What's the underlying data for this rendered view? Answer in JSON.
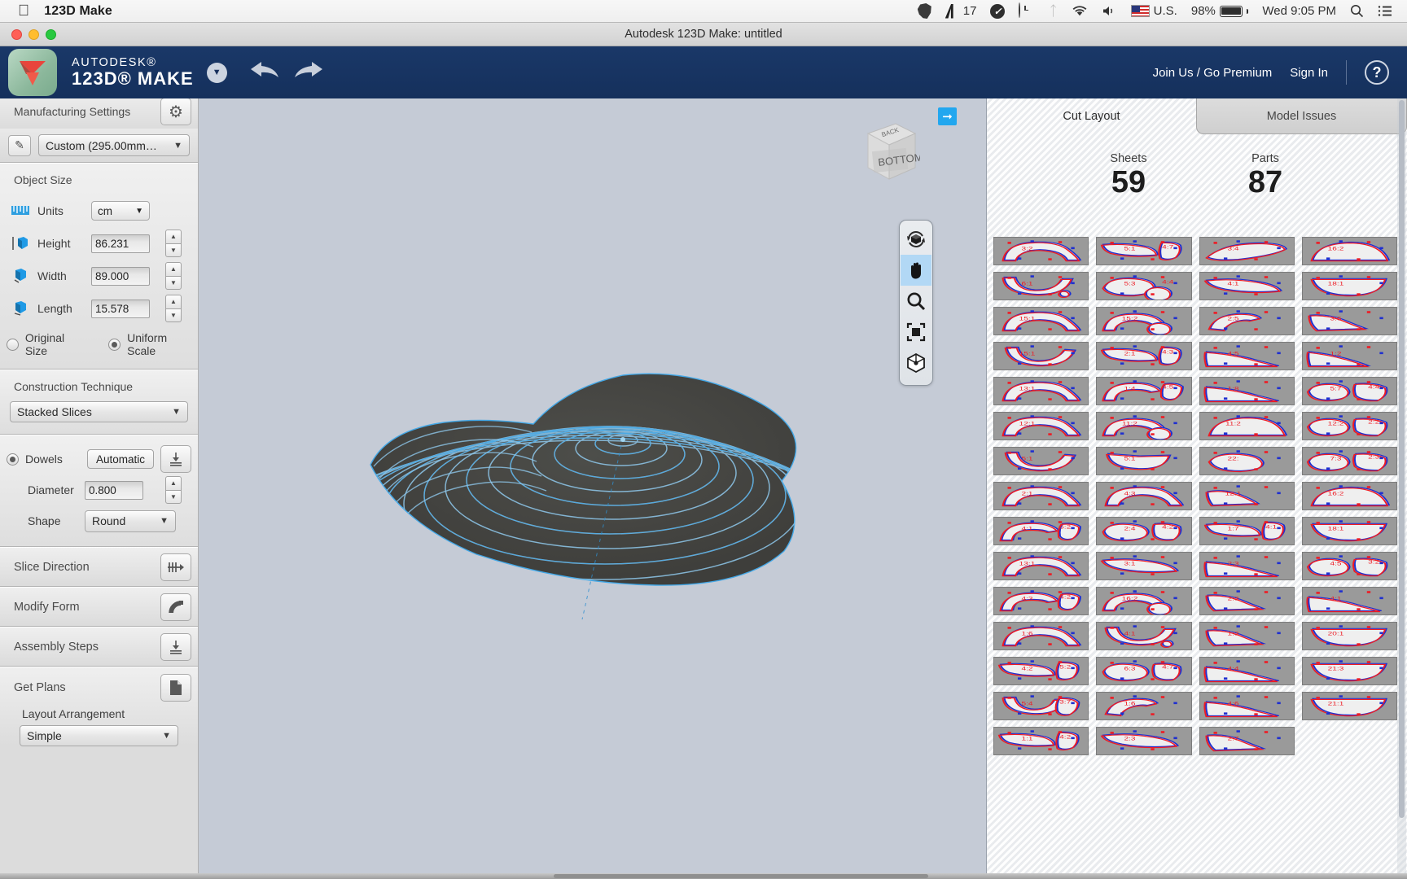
{
  "menubar": {
    "apple_icon": "apple-logo",
    "app_name": "123D Make",
    "status_items": [
      {
        "icon": "evernote-icon",
        "label": ""
      },
      {
        "icon": "autodesk-a-icon",
        "label": "17"
      },
      {
        "icon": "check-badge-icon",
        "label": ""
      },
      {
        "icon": "clock-icon",
        "label": ""
      },
      {
        "icon": "bluetooth-icon",
        "label": ""
      },
      {
        "icon": "wifi-icon",
        "label": ""
      },
      {
        "icon": "volume-icon",
        "label": ""
      },
      {
        "icon": "us-flag-icon",
        "label": "U.S."
      },
      {
        "icon": "battery-icon",
        "label": "98%"
      }
    ],
    "clock": "Wed 9:05 PM",
    "search_icon": "search-icon",
    "notification_icon": "list-icon"
  },
  "window": {
    "title": "Autodesk 123D Make: untitled"
  },
  "toolbar": {
    "brand_line1": "AUTODESK®",
    "brand_line2": "123D® MAKE",
    "dropdown_icon": "chevron-down-icon",
    "undo_icon": "undo-arrow-icon",
    "redo_icon": "redo-arrow-icon",
    "join_label": "Join Us / Go Premium",
    "signin_label": "Sign In",
    "help_label": "?"
  },
  "sidebar": {
    "manufacturing": {
      "title": "Manufacturing Settings",
      "gear_icon": "gear-icon",
      "pencil_icon": "pencil-icon",
      "material_value": "Custom (295.00mm…"
    },
    "object_size": {
      "title": "Object Size",
      "units_label": "Units",
      "units_value": "cm",
      "height_label": "Height",
      "height_value": "86.231",
      "width_label": "Width",
      "width_value": "89.000",
      "length_label": "Length",
      "length_value": "15.578",
      "original_size_label": "Original Size",
      "uniform_scale_label": "Uniform Scale",
      "selected_scale": "Uniform Scale"
    },
    "construction": {
      "title": "Construction Technique",
      "value": "Stacked Slices"
    },
    "dowels": {
      "label": "Dowels",
      "mode": "Automatic",
      "diameter_label": "Diameter",
      "diameter_value": "0.800",
      "shape_label": "Shape",
      "shape_value": "Round"
    },
    "sections": [
      {
        "label": "Slice Direction",
        "icon": "slice-direction-icon"
      },
      {
        "label": "Modify Form",
        "icon": "modify-form-icon"
      },
      {
        "label": "Assembly Steps",
        "icon": "assembly-steps-icon"
      }
    ],
    "get_plans": {
      "label": "Get Plans",
      "icon": "page-icon",
      "layout_label": "Layout Arrangement",
      "layout_value": "Simple"
    }
  },
  "viewport": {
    "expand_icon": "arrow-right-icon",
    "viewcube_top": "BACK",
    "viewcube_front": "BOTTOM",
    "nav_tools": [
      {
        "icon": "orbit-icon",
        "active": false
      },
      {
        "icon": "pan-hand-icon",
        "active": true
      },
      {
        "icon": "zoom-magnifier-icon",
        "active": false
      },
      {
        "icon": "fit-to-screen-icon",
        "active": false
      },
      {
        "icon": "view-cube-icon",
        "active": false
      }
    ]
  },
  "right_panel": {
    "tabs": [
      {
        "label": "Cut Layout",
        "active": true
      },
      {
        "label": "Model Issues",
        "active": false
      }
    ],
    "sheets_label": "Sheets",
    "sheets_value": "59",
    "parts_label": "Parts",
    "parts_value": "87",
    "thumbnails": [
      {
        "labels": [
          "3:2"
        ],
        "shape": "arch"
      },
      {
        "labels": [
          "5:1",
          "4:7"
        ],
        "shape": "sliver-pair"
      },
      {
        "labels": [
          "3:4"
        ],
        "shape": "blade"
      },
      {
        "labels": [
          "16:2"
        ],
        "shape": "dome"
      },
      {
        "labels": [
          "6:1"
        ],
        "shape": "bowl-dot"
      },
      {
        "labels": [
          "5:3",
          "4:4"
        ],
        "shape": "blob-circle"
      },
      {
        "labels": [
          "4:1"
        ],
        "shape": "sliver"
      },
      {
        "labels": [
          "18:1"
        ],
        "shape": "half-dome"
      },
      {
        "labels": [
          "15:1"
        ],
        "shape": "arch"
      },
      {
        "labels": [
          "15:2"
        ],
        "shape": "arch-circle"
      },
      {
        "labels": [
          "2:5"
        ],
        "shape": "hook"
      },
      {
        "labels": [
          "3:6"
        ],
        "shape": "wedge"
      },
      {
        "labels": [
          "15:1"
        ],
        "shape": "bowl"
      },
      {
        "labels": [
          "2:1",
          "4:3"
        ],
        "shape": "sliver-pair"
      },
      {
        "labels": [
          "4:5"
        ],
        "shape": "curve"
      },
      {
        "labels": [
          "1:2"
        ],
        "shape": "curve-box"
      },
      {
        "labels": [
          "13:1"
        ],
        "shape": "arch"
      },
      {
        "labels": [
          "1:4",
          "4:5"
        ],
        "shape": "arch-pair"
      },
      {
        "labels": [
          "1:8"
        ],
        "shape": "curve"
      },
      {
        "labels": [
          "5:7",
          "4:4"
        ],
        "shape": "double-blob"
      },
      {
        "labels": [
          "12:1"
        ],
        "shape": "arch"
      },
      {
        "labels": [
          "11:2"
        ],
        "shape": "arch-circle"
      },
      {
        "labels": [
          "11:2"
        ],
        "shape": "dome"
      },
      {
        "labels": [
          "12:2",
          "2:2"
        ],
        "shape": "double-blob"
      },
      {
        "labels": [
          "5:1"
        ],
        "shape": "bowl"
      },
      {
        "labels": [
          "5:1"
        ],
        "shape": "bowl-small"
      },
      {
        "labels": [
          "22:"
        ],
        "shape": "blob"
      },
      {
        "labels": [
          "7:3",
          "2:3"
        ],
        "shape": "double-blob"
      },
      {
        "labels": [
          "2:1"
        ],
        "shape": "arch"
      },
      {
        "labels": [
          "4:3"
        ],
        "shape": "arch"
      },
      {
        "labels": [
          "12:1"
        ],
        "shape": "wedge-box"
      },
      {
        "labels": [
          "16:2"
        ],
        "shape": "dome"
      },
      {
        "labels": [
          "4:1",
          "5:2"
        ],
        "shape": "arch-pair"
      },
      {
        "labels": [
          "2:4",
          "4:2"
        ],
        "shape": "blob-pair"
      },
      {
        "labels": [
          "1:7",
          "4:1"
        ],
        "shape": "sliver-pair"
      },
      {
        "labels": [
          "18:1"
        ],
        "shape": "half-dome"
      },
      {
        "labels": [
          "13:1"
        ],
        "shape": "arch"
      },
      {
        "labels": [
          "3:1"
        ],
        "shape": "sliver"
      },
      {
        "labels": [
          "2:3"
        ],
        "shape": "curve"
      },
      {
        "labels": [
          "4:5",
          "3:2"
        ],
        "shape": "double-blob"
      },
      {
        "labels": [
          "4:3",
          "4:2"
        ],
        "shape": "arch-pair"
      },
      {
        "labels": [
          "16:2"
        ],
        "shape": "arch-circle"
      },
      {
        "labels": [
          "2:3"
        ],
        "shape": "wedge"
      },
      {
        "labels": [
          "4:1"
        ],
        "shape": "curve"
      },
      {
        "labels": [
          "1:6"
        ],
        "shape": "arch"
      },
      {
        "labels": [
          "4:1"
        ],
        "shape": "bowl-dot"
      },
      {
        "labels": [
          "1:3"
        ],
        "shape": "wedge"
      },
      {
        "labels": [
          "20:1"
        ],
        "shape": "half-dome"
      },
      {
        "labels": [
          "4:2",
          "5:2"
        ],
        "shape": "sliver-pair"
      },
      {
        "labels": [
          "6:3",
          "4:7"
        ],
        "shape": "blob-pair"
      },
      {
        "labels": [
          "4:4"
        ],
        "shape": "curve"
      },
      {
        "labels": [
          "21:3"
        ],
        "shape": "half-dome"
      },
      {
        "labels": [
          "5:4",
          "3:7"
        ],
        "shape": "bowl-pair"
      },
      {
        "labels": [
          "1:6"
        ],
        "shape": "hook"
      },
      {
        "labels": [
          "4:6"
        ],
        "shape": "curve"
      },
      {
        "labels": [
          "21:1"
        ],
        "shape": "half-dome"
      },
      {
        "labels": [
          "1:1",
          "4:2"
        ],
        "shape": "sliver-pair"
      },
      {
        "labels": [
          "2:3"
        ],
        "shape": "sliver"
      },
      {
        "labels": [
          "2:7"
        ],
        "shape": "wedge"
      }
    ]
  },
  "colors": {
    "brand_blue": "#17305c",
    "accent_blue": "#22a7ef",
    "cut_red": "#ee1b24",
    "cut_blue": "#1f2fd0",
    "viewport_bg": "#c5cbd6",
    "model_slice": "#2f9fe0"
  }
}
